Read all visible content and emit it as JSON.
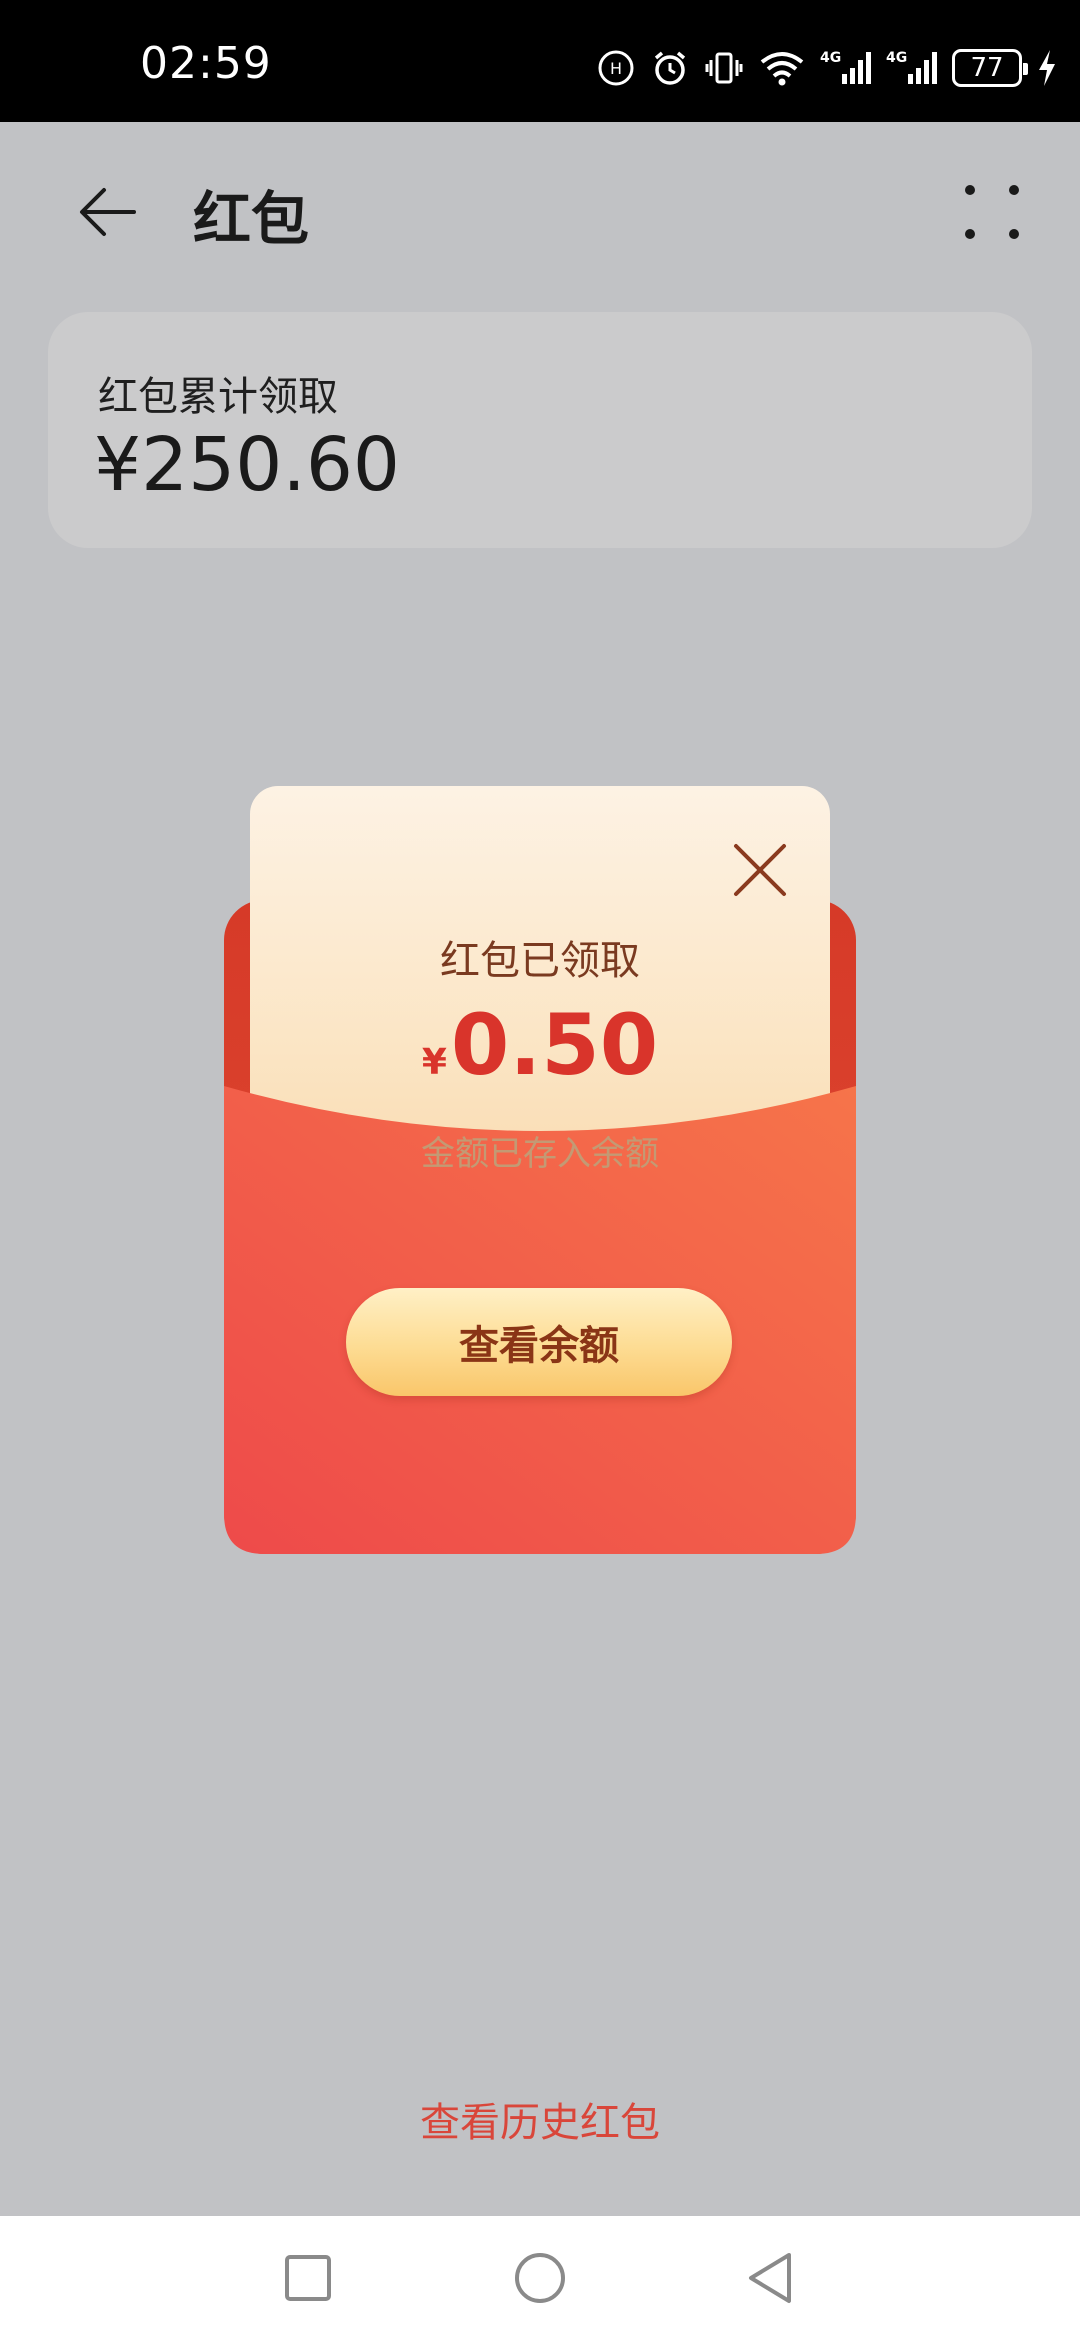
{
  "status_bar": {
    "time": "02:59",
    "battery": "77",
    "icons": [
      "hd-icon",
      "alarm-icon",
      "vibrate-icon",
      "wifi-icon",
      "signal-4g-icon",
      "signal-4g-icon",
      "battery-icon",
      "charging-icon"
    ]
  },
  "app_bar": {
    "title": "红包"
  },
  "summary": {
    "label": "红包累计领取",
    "amount": "¥250.60"
  },
  "envelope": {
    "title": "红包已领取",
    "currency": "¥",
    "amount": "0.50",
    "note": "金额已存入余额",
    "button_label": "查看余额"
  },
  "history_link": "查看历史红包",
  "colors": {
    "accent_red": "#d9342b",
    "envelope_red": "#e24d34",
    "button_gold": "#fddc93",
    "background": "#c1c2c5"
  }
}
